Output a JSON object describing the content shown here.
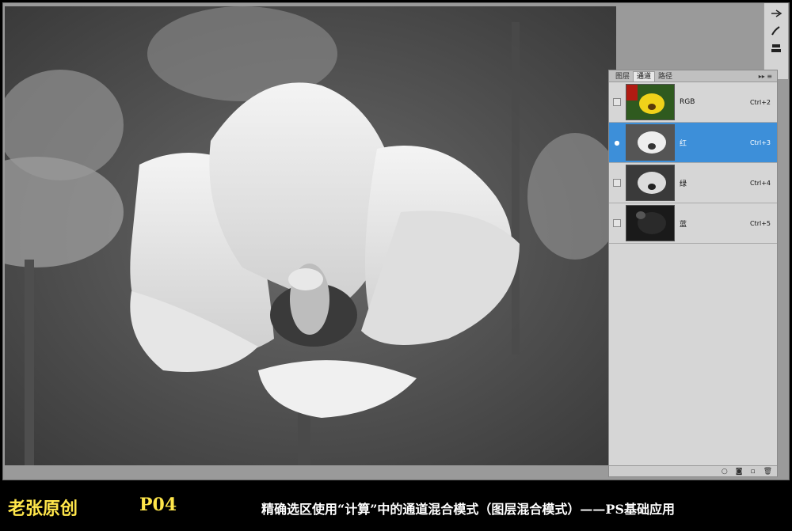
{
  "panel": {
    "tabs": [
      "图层",
      "通道",
      "路径"
    ],
    "active_tab": "通道",
    "menu_icon": "panel-menu-icon",
    "channels": [
      {
        "name": "RGB",
        "shortcut": "Ctrl+2",
        "selected": false,
        "visible": false
      },
      {
        "name": "红",
        "shortcut": "Ctrl+3",
        "selected": true,
        "visible": true
      },
      {
        "name": "绿",
        "shortcut": "Ctrl+4",
        "selected": false,
        "visible": false
      },
      {
        "name": "蓝",
        "shortcut": "Ctrl+5",
        "selected": false,
        "visible": false
      }
    ],
    "footer_icons": [
      "load-selection-icon",
      "save-selection-icon",
      "new-channel-icon",
      "delete-channel-icon"
    ]
  },
  "toolbar": {
    "icons": [
      "pen-tool-icon",
      "brush-tool-icon",
      "stamp-tool-icon"
    ]
  },
  "footer": {
    "signature": "老张原创",
    "page": "P04",
    "caption": "精确选区使用“计算”中的通道混合模式（图层混合模式）——PS基础应用"
  },
  "colors": {
    "selection": "#3d8fd9",
    "signature": "#ffe64a",
    "caption": "#ffffff"
  }
}
